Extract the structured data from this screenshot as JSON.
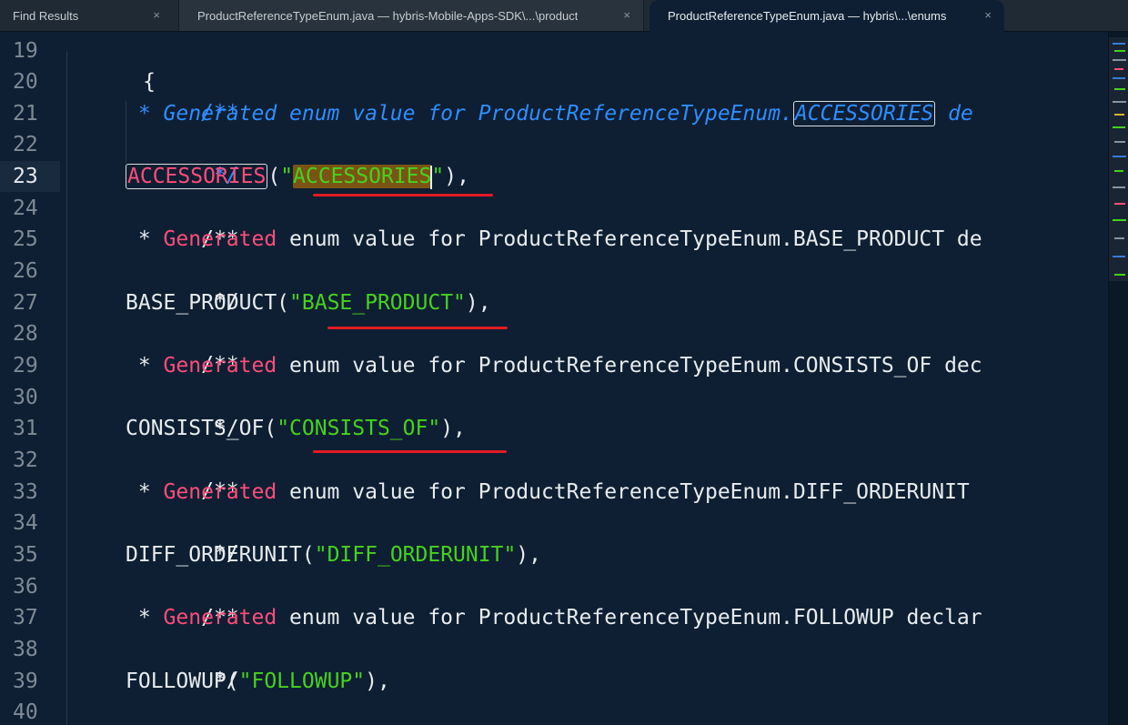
{
  "tabs": [
    {
      "label": "Find Results",
      "close": "×"
    },
    {
      "label": "ProductReferenceTypeEnum.java — hybris-Mobile-Apps-SDK\\...\\product",
      "close": "×"
    },
    {
      "label": "ProductReferenceTypeEnum.java — hybris\\...\\enums",
      "close": "×"
    }
  ],
  "editor": {
    "current_line": 23,
    "lines": [
      {
        "num": "19",
        "text": "{"
      },
      {
        "num": "20",
        "text": "/**"
      },
      {
        "num": "21",
        "star": " * ",
        "gen": "Generated",
        "rest": " enum value for ProductReferenceTypeEnum.",
        "boxed": "ACCESSORIES",
        "tail": " de"
      },
      {
        "num": "22",
        "text": " */"
      },
      {
        "num": "23",
        "ident": "ACCESSORIES",
        "open": "(",
        "q1": "\"",
        "str": "ACCESSORIES",
        "q2": "\"",
        "close": "),"
      },
      {
        "num": "24",
        "text": "/**"
      },
      {
        "num": "25",
        "star": " * ",
        "gen": "Generated",
        "rest": " enum value for ProductReferenceTypeEnum.BASE_PRODUCT de"
      },
      {
        "num": "26",
        "text": " */"
      },
      {
        "num": "27",
        "ident": "BASE_PRODUCT",
        "open": "(",
        "str": "\"BASE_PRODUCT\"",
        "close": "),"
      },
      {
        "num": "28",
        "text": "/**"
      },
      {
        "num": "29",
        "star": " * ",
        "gen": "Generated",
        "rest": " enum value for ProductReferenceTypeEnum.CONSISTS_OF dec"
      },
      {
        "num": "30",
        "text": " */"
      },
      {
        "num": "31",
        "ident": "CONSISTS_OF",
        "open": "(",
        "str": "\"CONSISTS_OF\"",
        "close": "),"
      },
      {
        "num": "32",
        "text": "/**"
      },
      {
        "num": "33",
        "star": " * ",
        "gen": "Generated",
        "rest": " enum value for ProductReferenceTypeEnum.DIFF_ORDERUNIT"
      },
      {
        "num": "34",
        "text": " */"
      },
      {
        "num": "35",
        "ident": "DIFF_ORDERUNIT",
        "open": "(",
        "str": "\"DIFF_ORDERUNIT\"",
        "close": "),"
      },
      {
        "num": "36",
        "text": "/**"
      },
      {
        "num": "37",
        "star": " * ",
        "gen": "Generated",
        "rest": " enum value for ProductReferenceTypeEnum.FOLLOWUP declar"
      },
      {
        "num": "38",
        "text": " */"
      },
      {
        "num": "39",
        "ident": "FOLLOWUP",
        "open": "(",
        "str": "\"FOLLOWUP\"",
        "close": "),"
      },
      {
        "num": "40",
        "text": "/**"
      }
    ]
  },
  "colors": {
    "background": "#0e1f33",
    "comment_blue": "#2f8dff",
    "keyword_pink": "#ff4d7a",
    "string_green": "#46d21f",
    "annotation_red": "#e31b23"
  }
}
